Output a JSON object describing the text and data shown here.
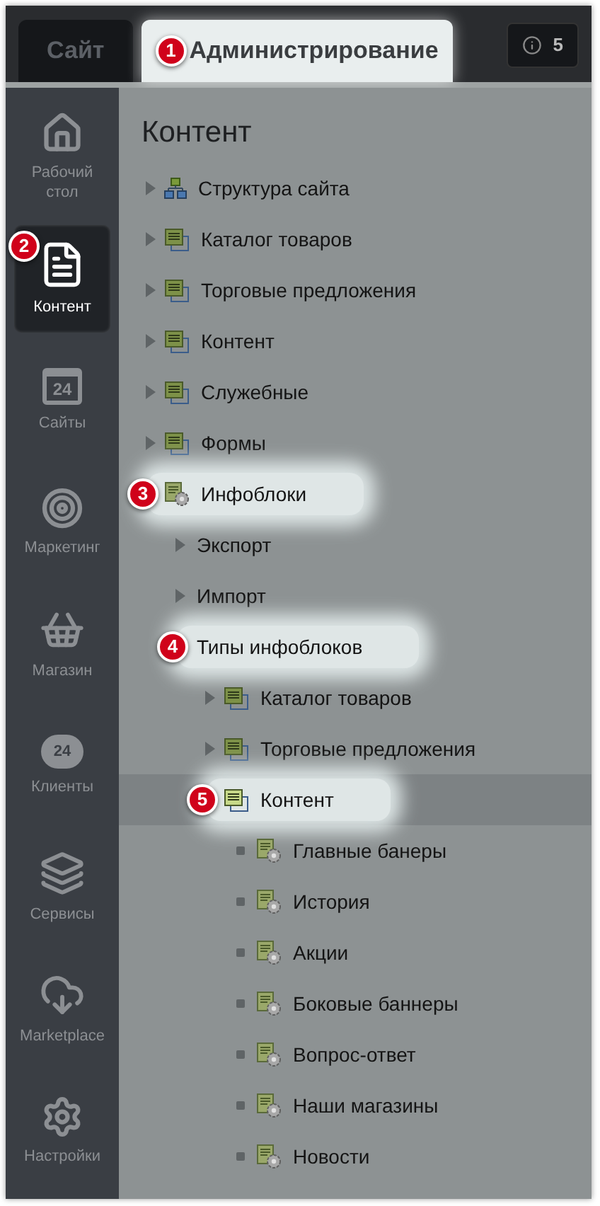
{
  "tabs": [
    {
      "label": "Сайт",
      "selected": false
    },
    {
      "label": "Администрирование",
      "selected": true,
      "callout": "1"
    }
  ],
  "notifications": {
    "count": "5"
  },
  "sidebar": {
    "items": [
      {
        "label": "Рабочий стол",
        "selected": false
      },
      {
        "label": "Контент",
        "selected": true,
        "callout": "2"
      },
      {
        "label": "Сайты",
        "icon_text": "24",
        "selected": false
      },
      {
        "label": "Маркетинг",
        "selected": false
      },
      {
        "label": "Магазин",
        "selected": false
      },
      {
        "label": "Клиенты",
        "icon_text": "24",
        "selected": false
      },
      {
        "label": "Сервисы",
        "selected": false
      },
      {
        "label": "Marketplace",
        "selected": false
      },
      {
        "label": "Настройки",
        "selected": false
      }
    ]
  },
  "content": {
    "title": "Контент",
    "tree": [
      {
        "label": "Структура сайта",
        "kind": "structure",
        "expanded": false
      },
      {
        "label": "Каталог товаров",
        "kind": "type",
        "expanded": false
      },
      {
        "label": "Торговые предложения",
        "kind": "type",
        "expanded": false
      },
      {
        "label": "Контент",
        "kind": "type",
        "expanded": false
      },
      {
        "label": "Служебные",
        "kind": "type",
        "expanded": false
      },
      {
        "label": "Формы",
        "kind": "type",
        "expanded": false
      },
      {
        "label": "Инфоблоки",
        "kind": "iblock",
        "expanded": true,
        "callout": "3",
        "highlighted": true,
        "selected": false,
        "children": [
          {
            "label": "Экспорт",
            "kind": "plain",
            "expanded": false
          },
          {
            "label": "Импорт",
            "kind": "plain",
            "expanded": false
          },
          {
            "label": "Типы инфоблоков",
            "kind": "plain",
            "expanded": true,
            "callout": "4",
            "highlighted": true,
            "selected": false,
            "children": [
              {
                "label": "Каталог товаров",
                "kind": "type",
                "expanded": false
              },
              {
                "label": "Торговые предложения",
                "kind": "type",
                "expanded": false
              },
              {
                "label": "Контент",
                "kind": "type",
                "expanded": true,
                "callout": "5",
                "highlighted": true,
                "selected": true,
                "children": [
                  {
                    "label": "Главные банеры",
                    "kind": "element"
                  },
                  {
                    "label": "История",
                    "kind": "element"
                  },
                  {
                    "label": "Акции",
                    "kind": "element"
                  },
                  {
                    "label": "Боковые баннеры",
                    "kind": "element"
                  },
                  {
                    "label": "Вопрос-ответ",
                    "kind": "element"
                  },
                  {
                    "label": "Наши магазины",
                    "kind": "element"
                  },
                  {
                    "label": "Новости",
                    "kind": "element"
                  }
                ]
              }
            ]
          }
        ]
      }
    ]
  }
}
